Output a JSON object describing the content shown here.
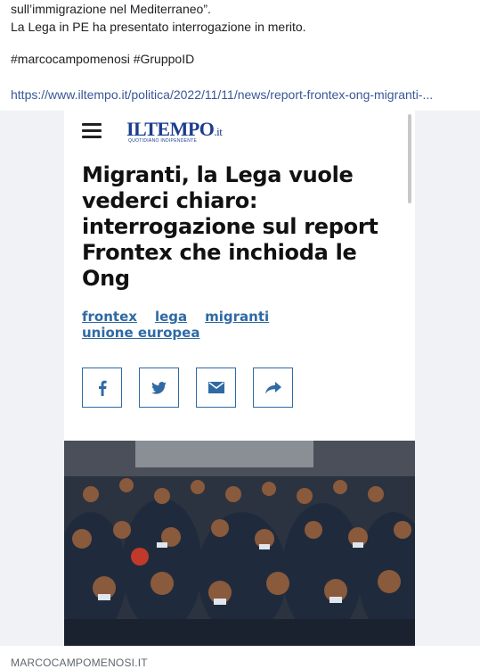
{
  "post": {
    "text_lines": [
      "sull’immigrazione nel Mediterraneo”.",
      "La Lega in PE ha presentato interrogazione in merito."
    ],
    "hashtags": "#marcocampomenosi #GruppoID",
    "link": "https://www.iltempo.it/politica/2022/11/11/news/report-frontex-ong-migranti-..."
  },
  "article": {
    "logo": "ILTEMPO",
    "logo_suffix": ".it",
    "logo_tagline": "QUOTIDIANO INDIPENDENTE",
    "headline": "Migranti, la Lega vuole vederci chiaro: interrogazione sul report Frontex che inchioda le Ong",
    "tags": [
      "frontex",
      "lega",
      "migranti",
      "unione europea"
    ],
    "share_icons": [
      "facebook-icon",
      "twitter-icon",
      "mail-icon",
      "share-arrow-icon"
    ],
    "photo_alt_colors": {
      "background": "#2b3340",
      "accent": "#c0392b"
    }
  },
  "source": "MARCOCAMPOMENOSI.IT"
}
